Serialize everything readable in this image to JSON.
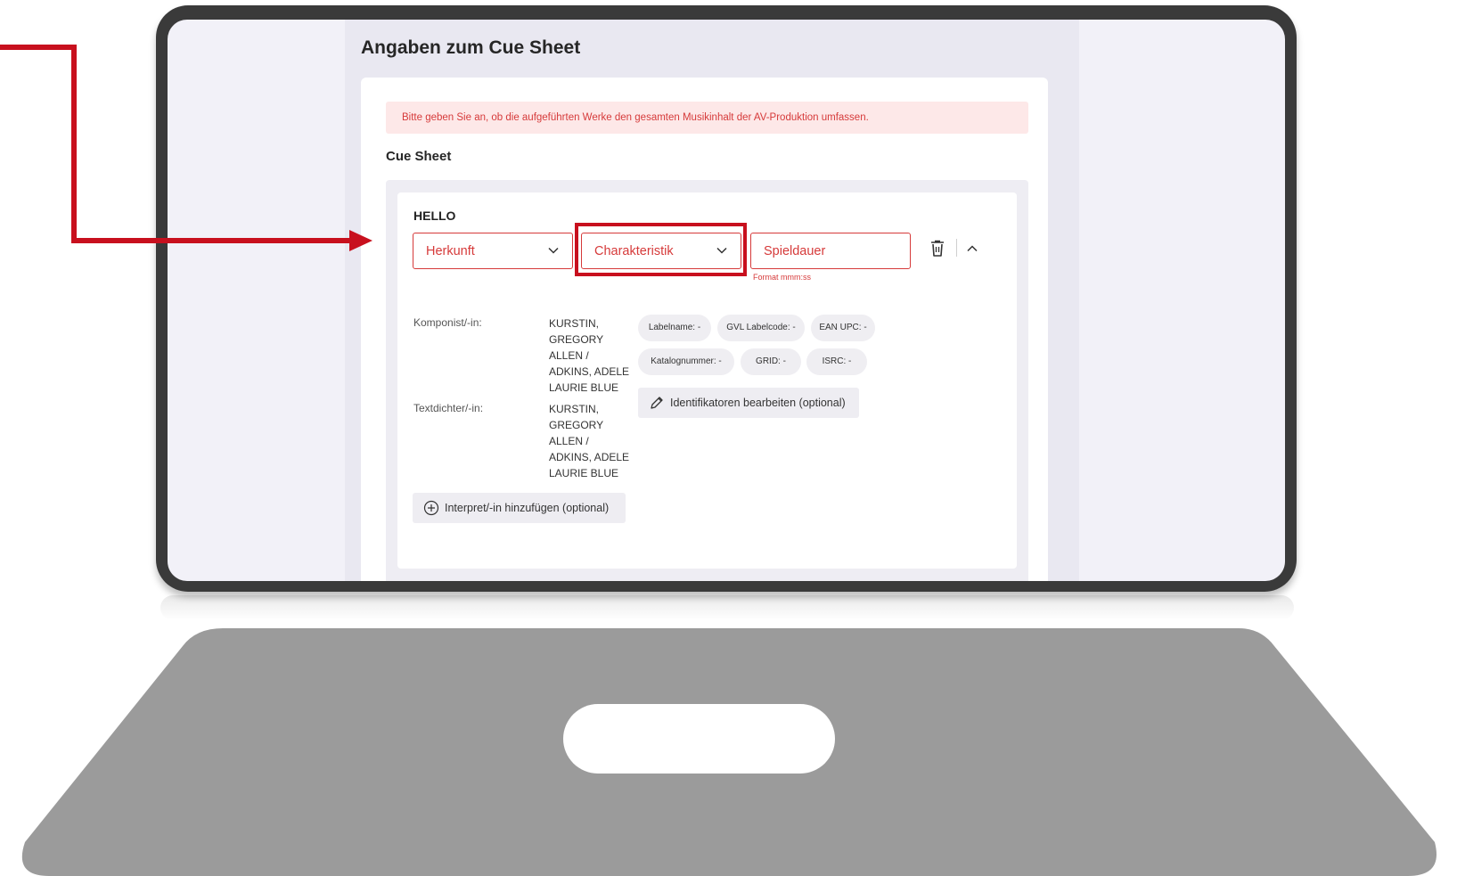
{
  "page": {
    "title": "Angaben zum Cue Sheet",
    "alert": "Bitte geben Sie an, ob die aufgeführten Werke den gesamten Musikinhalt der AV-Produktion umfassen.",
    "section_title": "Cue Sheet"
  },
  "cue": {
    "name": "HELLO",
    "origin_placeholder": "Herkunft",
    "characteristic_placeholder": "Charakteristik",
    "duration_placeholder": "Spieldauer",
    "duration_hint": "Format mmm:ss",
    "composer_label": "Komponist/-in:",
    "composer_lines": [
      "KURSTIN,",
      "GREGORY",
      "ALLEN /",
      "ADKINS, ADELE",
      "LAURIE BLUE"
    ],
    "lyricist_label": "Textdichter/-in:",
    "lyricist_lines": [
      "KURSTIN,",
      "GREGORY",
      "ALLEN /",
      "ADKINS, ADELE",
      "LAURIE BLUE"
    ],
    "chips": [
      "Labelname: -",
      "GVL Labelcode: -",
      "EAN UPC: -",
      "Katalognummer: -",
      "GRID: -",
      "ISRC: -"
    ],
    "edit_identifiers_label": "Identifikatoren bearbeiten (optional)",
    "add_performer_label": "Interpret/-in hinzufügen (optional)"
  },
  "colors": {
    "accent_red": "#d63a3a",
    "callout_red": "#c8101e",
    "alert_bg": "#fde8e8",
    "laptop_frame": "#3a3a3a",
    "laptop_base": "#9b9b9b"
  },
  "icons": {
    "dropdown": "chevron-down-icon",
    "delete": "trash-icon",
    "collapse": "chevron-up-icon",
    "edit": "pencil-icon",
    "add": "plus-circle-icon"
  }
}
